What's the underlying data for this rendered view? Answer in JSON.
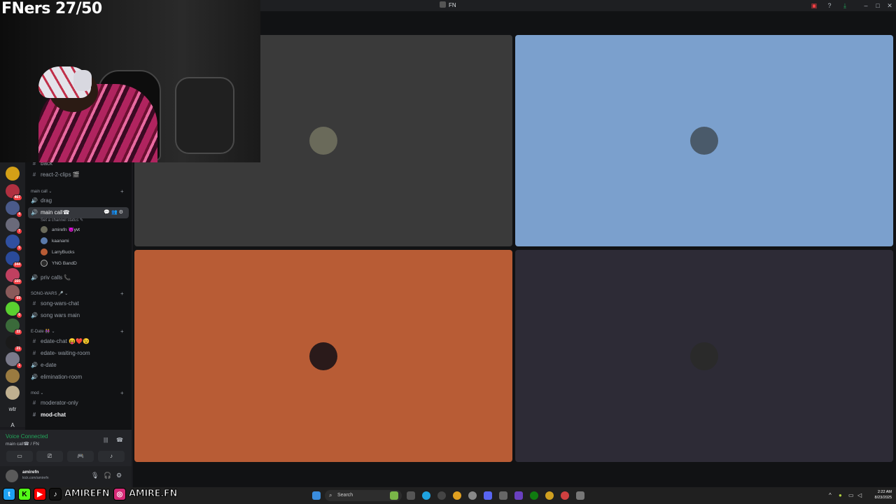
{
  "window": {
    "title": "FN"
  },
  "overlay": {
    "caption": "FNers 27/50"
  },
  "servers": [
    {
      "badge": ""
    },
    {
      "badge": "467"
    },
    {
      "badge": "4"
    },
    {
      "badge": "7"
    },
    {
      "badge": "5"
    },
    {
      "badge": "344"
    },
    {
      "badge": "160"
    },
    {
      "badge": "69"
    },
    {
      "badge": "6"
    },
    {
      "badge": "22"
    },
    {
      "badge": "21"
    },
    {
      "badge": "1"
    },
    {
      "badge": ""
    },
    {
      "badge": ""
    }
  ],
  "server_text": [
    "wtr",
    "A"
  ],
  "channels": {
    "top": [
      {
        "name": "back"
      },
      {
        "name": "react-2-clips 🎬"
      }
    ],
    "cat_main": "main call",
    "main_call": [
      {
        "name": "drag"
      },
      {
        "name": "main call☎",
        "status": "Set a channel status ✎"
      }
    ],
    "voice_users": [
      {
        "name": "amirefn",
        "tag": "😈yvt"
      },
      {
        "name": "kaanami",
        "tag": ""
      },
      {
        "name": "LarryBucks",
        "tag": ""
      },
      {
        "name": "YNG BandD",
        "tag": ""
      }
    ],
    "priv": "priv calls 📞",
    "cat_song": "SONG-WARS 🎤",
    "song": [
      {
        "name": "song-wars-chat"
      },
      {
        "name": "song wars main"
      }
    ],
    "cat_edate": "E-Date 👭",
    "edate": [
      {
        "name": "edate-chat 😝❤️😉"
      },
      {
        "name": "edate- waiting-room"
      },
      {
        "name": "e-date"
      },
      {
        "name": "elimination-room"
      }
    ],
    "cat_mod": "mod",
    "mod": [
      {
        "name": "moderator-only"
      },
      {
        "name": "mod-chat"
      }
    ]
  },
  "voice_panel": {
    "status": "Voice Connected",
    "channel": "main call☎ / FN"
  },
  "user_panel": {
    "name": "amirefn",
    "sub": "kick.com/amirefn"
  },
  "tiles": [
    {
      "color": "#3a3a3a",
      "avatar": "#6a6a5a"
    },
    {
      "color": "#7ba0cd",
      "avatar": "#4a5a6a"
    },
    {
      "color": "#b85c35",
      "avatar": "#2a1a1a"
    },
    {
      "color": "#2d2b36",
      "avatar": "#2a2a2a"
    }
  ],
  "social": {
    "handle1": "AMIREFN",
    "handle2": "AMIRE.FN"
  },
  "taskbar": {
    "search": "Search",
    "time": "2:22 AM",
    "date": "8/23/2025"
  },
  "icons": [
    "hash-icon",
    "speaker-icon",
    "plus-icon",
    "mic-icon",
    "headphones-icon",
    "gear-icon",
    "phone-icon",
    "search-icon",
    "windows-icon"
  ]
}
